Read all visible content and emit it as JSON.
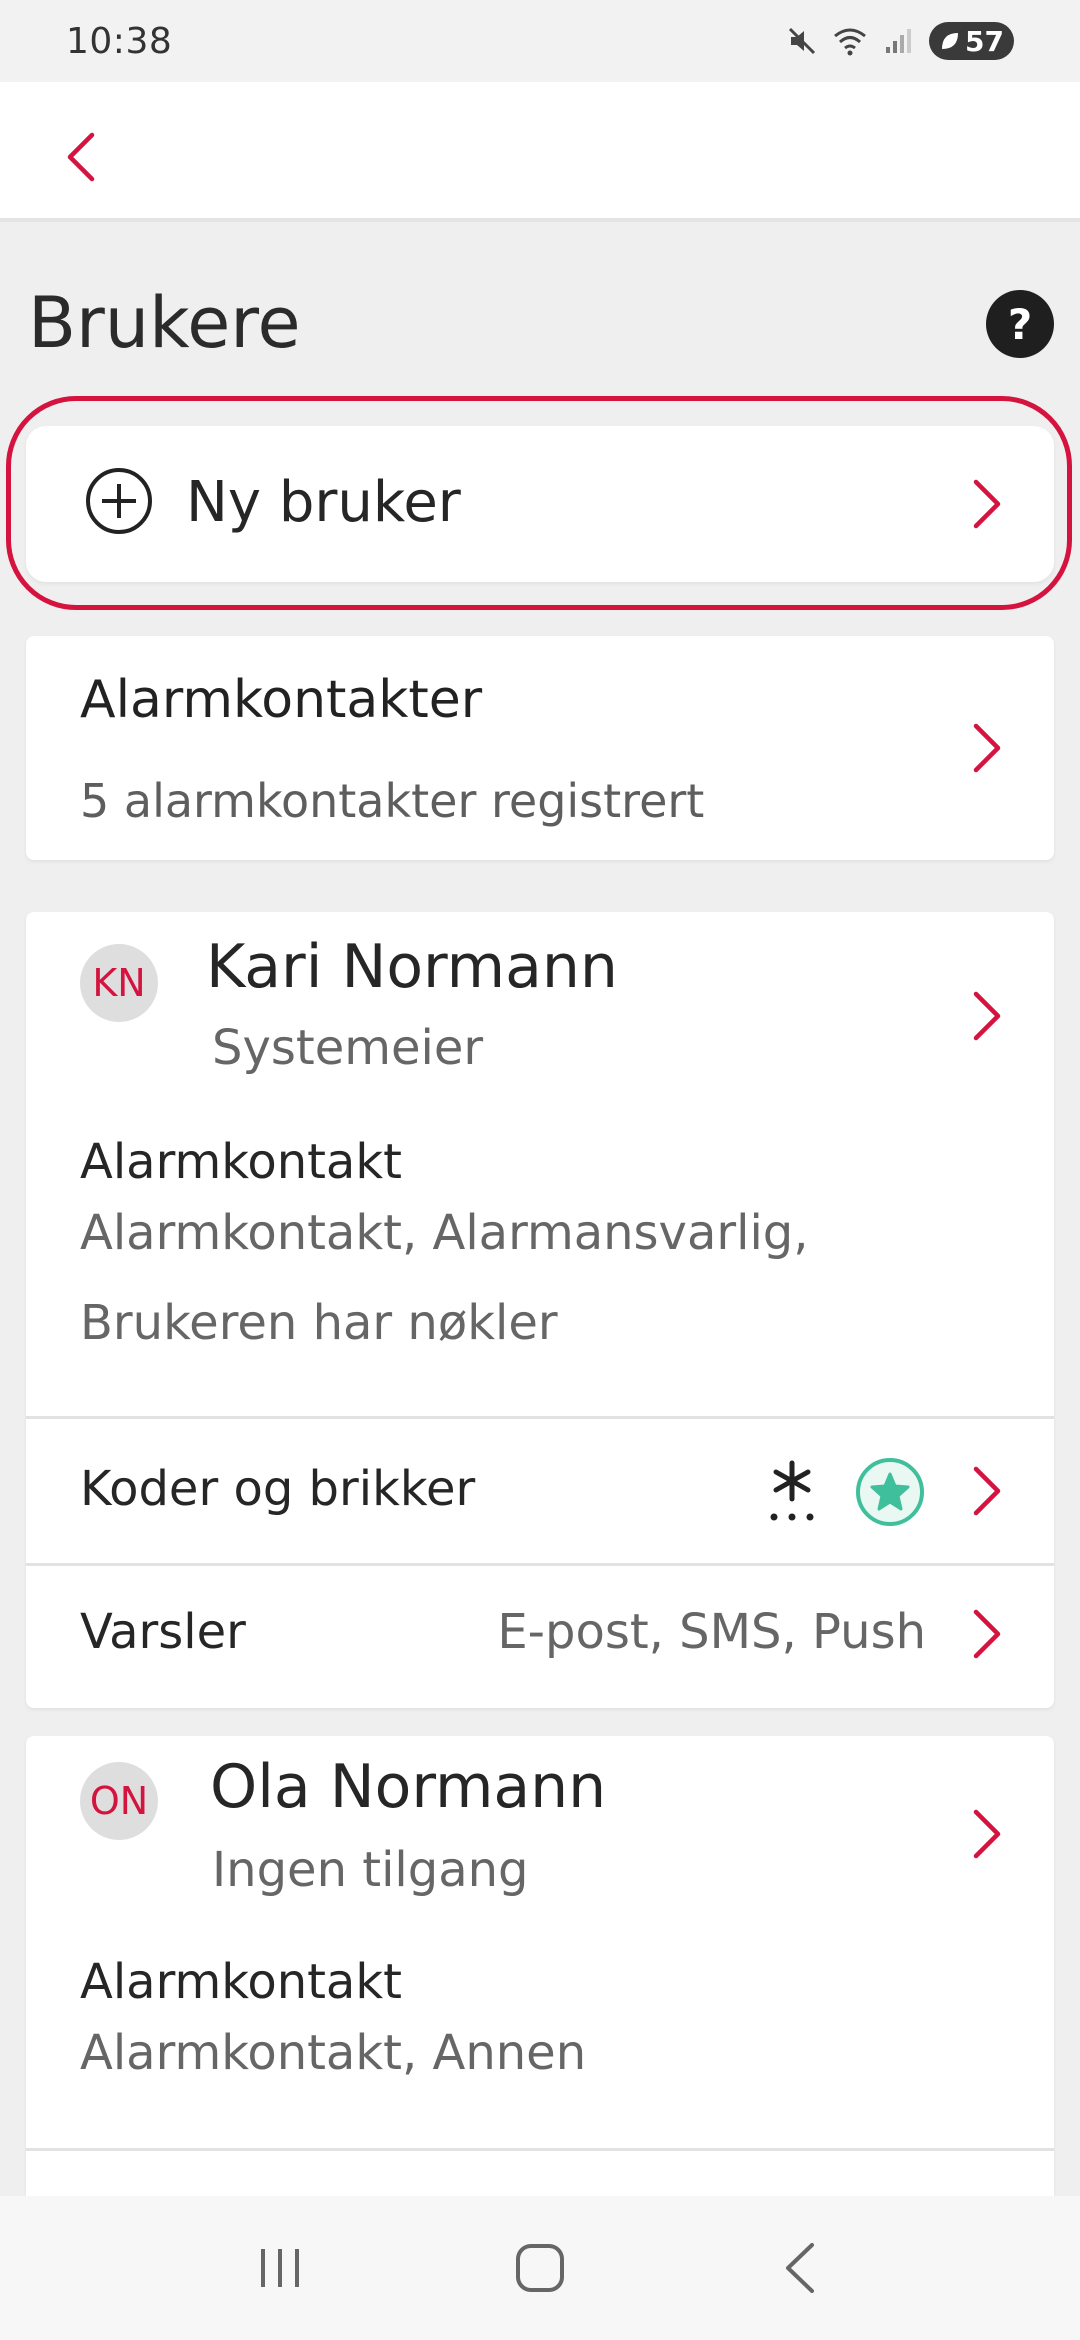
{
  "status_bar": {
    "time": "10:38",
    "battery": "57"
  },
  "header": {
    "title": "Brukere",
    "help_label": "?"
  },
  "new_user": {
    "label": "Ny bruker"
  },
  "alarm_contacts": {
    "title": "Alarmkontakter",
    "subtitle": "5 alarmkontakter registrert"
  },
  "users": [
    {
      "initials": "KN",
      "name": "Kari Normann",
      "role": "Systemeier",
      "section_label": "Alarmkontakt",
      "section_value_line1": "Alarmkontakt, Alarmansvarlig,",
      "section_value_line2": "Brukeren har nøkler",
      "codes_label": "Koder og brikker",
      "notifications_label": "Varsler",
      "notifications_value": "E-post, SMS, Push"
    },
    {
      "initials": "ON",
      "name": "Ola Normann",
      "role": "Ingen tilgang",
      "section_label": "Alarmkontakt",
      "section_value_line1": "Alarmkontakt, Annen"
    }
  ],
  "colors": {
    "accent": "#d4133f",
    "badge_green": "#3fbf9b",
    "background": "#efefef"
  },
  "icons": {
    "back": "chevron-left-icon",
    "help": "question-icon",
    "add": "plus-circle-icon",
    "chevron": "chevron-right-icon",
    "code": "asterisk-code-icon",
    "tag": "star-badge-icon"
  }
}
